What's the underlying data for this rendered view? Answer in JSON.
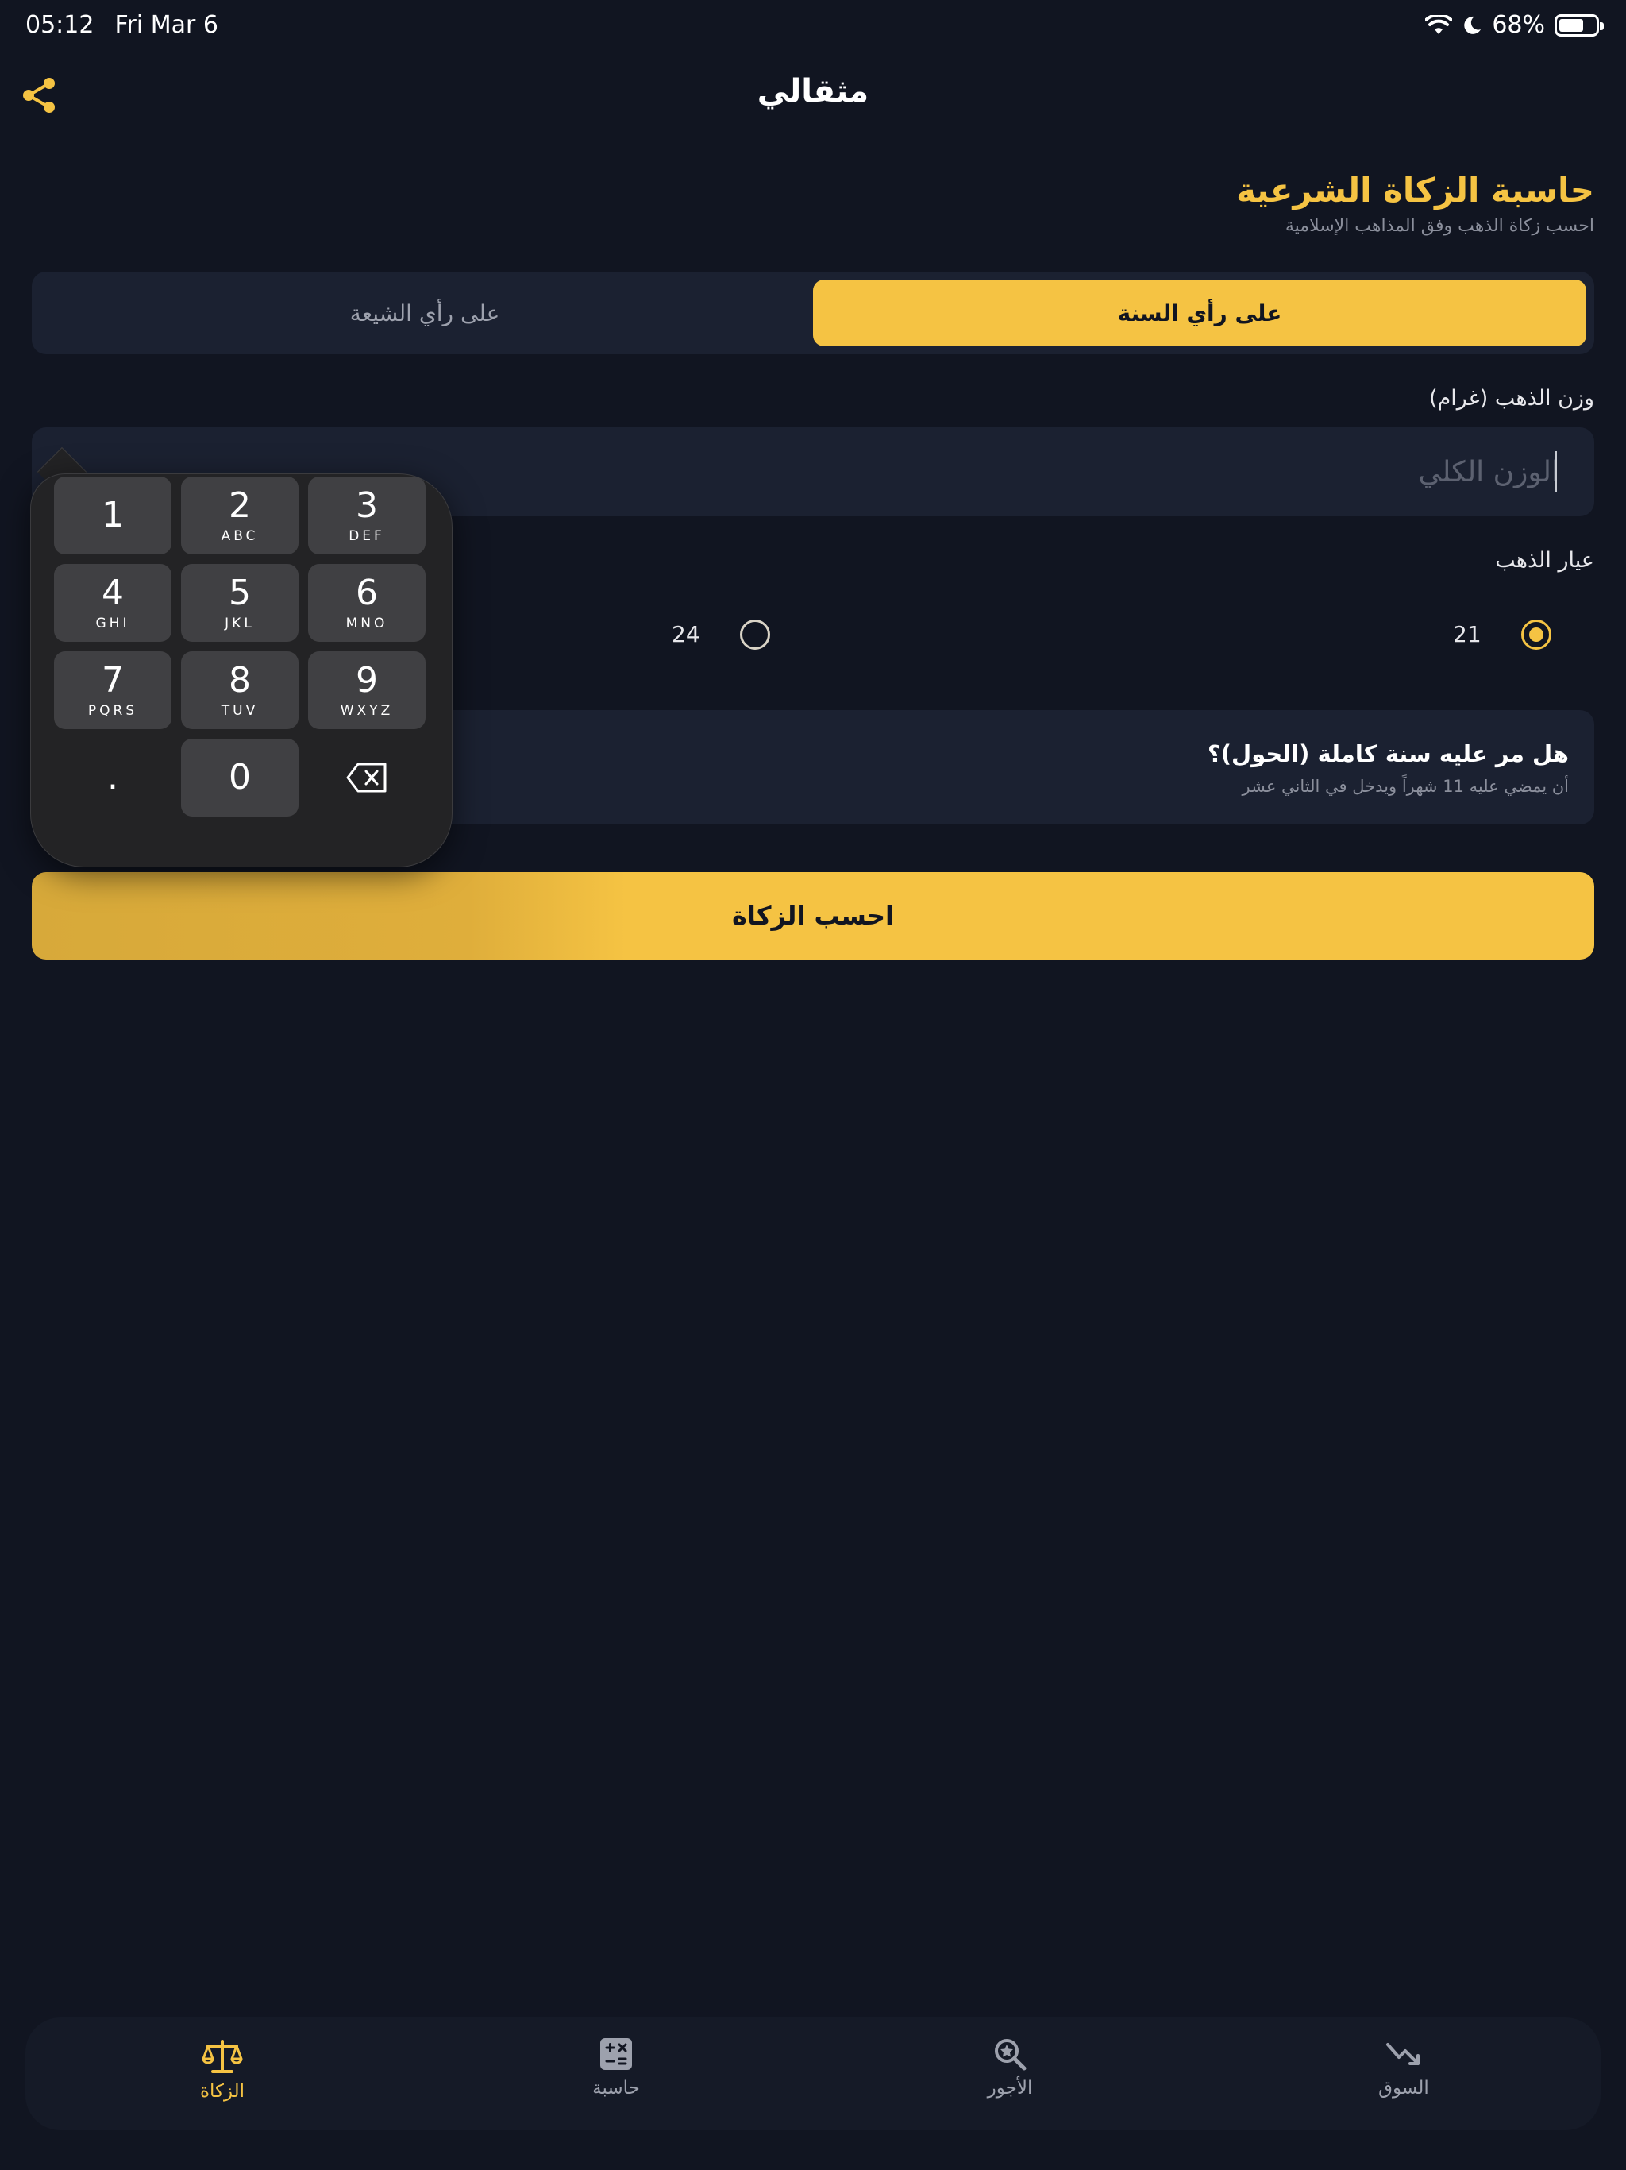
{
  "status_bar": {
    "time": "05:12",
    "date": "Fri Mar 6",
    "battery": "68%",
    "battery_level": 0.68
  },
  "header": {
    "title": "مثقالي"
  },
  "calculator": {
    "title": "حاسبة الزكاة الشرعية",
    "subtitle": "احسب زكاة الذهب وفق المذاهب الإسلامية",
    "segments": {
      "sunni": "على رأي السنة",
      "shia": "على رأي الشيعة",
      "selected": "sunni"
    },
    "weight_label": "وزن الذهب (غرام)",
    "weight_placeholder": "الوزن الكلي",
    "weight_value": "",
    "karat_label": "عيار الذهب",
    "karats": [
      {
        "label": "21",
        "selected": true
      },
      {
        "label": "24",
        "selected": false
      }
    ],
    "hawl_question": "هل مر عليه سنة كاملة (الحول)؟",
    "hawl_note": "أن يمضي عليه 11 شهراً ويدخل في الثاني عشر",
    "calculate_button": "احسب الزكاة"
  },
  "keypad": {
    "keys": [
      {
        "num": "1",
        "letters": ""
      },
      {
        "num": "2",
        "letters": "ABC"
      },
      {
        "num": "3",
        "letters": "DEF"
      },
      {
        "num": "4",
        "letters": "GHI"
      },
      {
        "num": "5",
        "letters": "JKL"
      },
      {
        "num": "6",
        "letters": "MNO"
      },
      {
        "num": "7",
        "letters": "PQRS"
      },
      {
        "num": "8",
        "letters": "TUV"
      },
      {
        "num": "9",
        "letters": "WXYZ"
      },
      {
        "num": ".",
        "letters": ""
      },
      {
        "num": "0",
        "letters": ""
      }
    ]
  },
  "tabs": [
    {
      "label": "الزكاة",
      "icon": "scale-icon",
      "active": true
    },
    {
      "label": "حاسبة",
      "icon": "calculator-icon",
      "active": false
    },
    {
      "label": "الأجور",
      "icon": "search-wage-icon",
      "active": false
    },
    {
      "label": "السوق",
      "icon": "trend-down-icon",
      "active": false
    }
  ],
  "colors": {
    "background": "#111521",
    "card": "#1b2131",
    "accent": "#f5c343",
    "muted_text": "#8b8f9c"
  }
}
